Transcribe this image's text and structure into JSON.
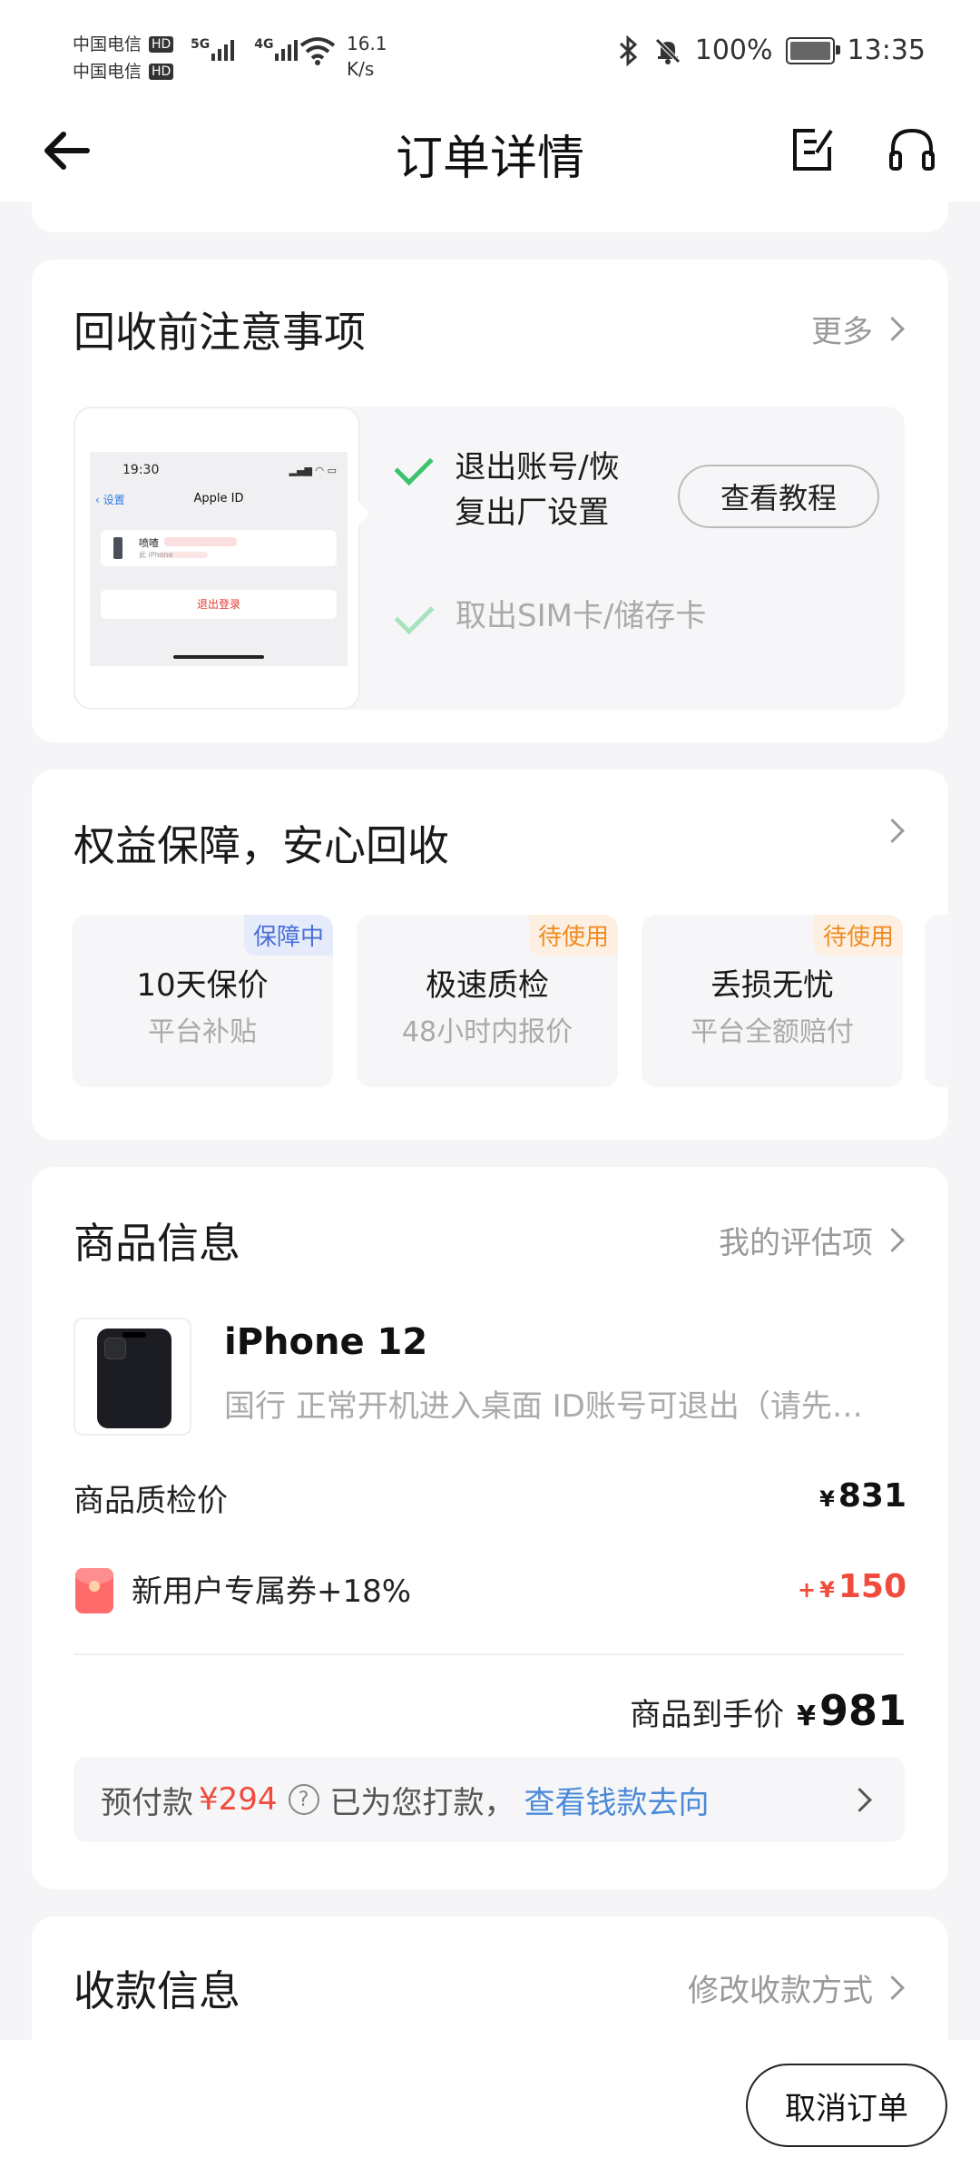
{
  "status_bar": {
    "carrier1": "中国电信",
    "carrier2": "中国电信",
    "hd": "HD",
    "net1": "5G",
    "net2": "4G",
    "speed_value": "16.1",
    "speed_unit": "K/s",
    "battery": "100%",
    "time": "13:35"
  },
  "header": {
    "title": "订单详情"
  },
  "notice": {
    "title": "回收前注意事项",
    "more": "更多",
    "phone_preview": {
      "time": "19:30",
      "back": "设置",
      "title": "Apple ID",
      "account_name": "喷喳",
      "account_sub": "此 iPhone",
      "logout": "退出登录"
    },
    "step1": "退出账号/恢复出厂设置",
    "step2": "取出SIM卡/储存卡",
    "tutorial_button": "查看教程"
  },
  "benefits": {
    "title": "权益保障，安心回收",
    "items": [
      {
        "tag": "保障中",
        "title": "10天保价",
        "subtitle": "平台补贴"
      },
      {
        "tag": "待使用",
        "title": "极速质检",
        "subtitle": "48小时内报价"
      },
      {
        "tag": "待使用",
        "title": "丢损无忧",
        "subtitle": "平台全额赔付"
      }
    ]
  },
  "product": {
    "section_title": "商品信息",
    "my_evaluation": "我的评估项",
    "name": "iPhone 12",
    "description": "国行 正常开机进入桌面 ID账号可退出（请先…",
    "inspection_label": "商品质检价",
    "inspection_price": "831",
    "coupon_label": "新用户专属券+18%",
    "coupon_prefix": "+",
    "coupon_amount": "150",
    "final_label": "商品到手价",
    "final_price": "981",
    "currency": "¥",
    "prepay_label": "预付款",
    "prepay_amount": "294",
    "prepay_paid": "已为您打款，",
    "prepay_link": "查看钱款去向"
  },
  "payment": {
    "title": "收款信息",
    "modify": "修改收款方式"
  },
  "footer": {
    "cancel_button": "取消订单"
  }
}
